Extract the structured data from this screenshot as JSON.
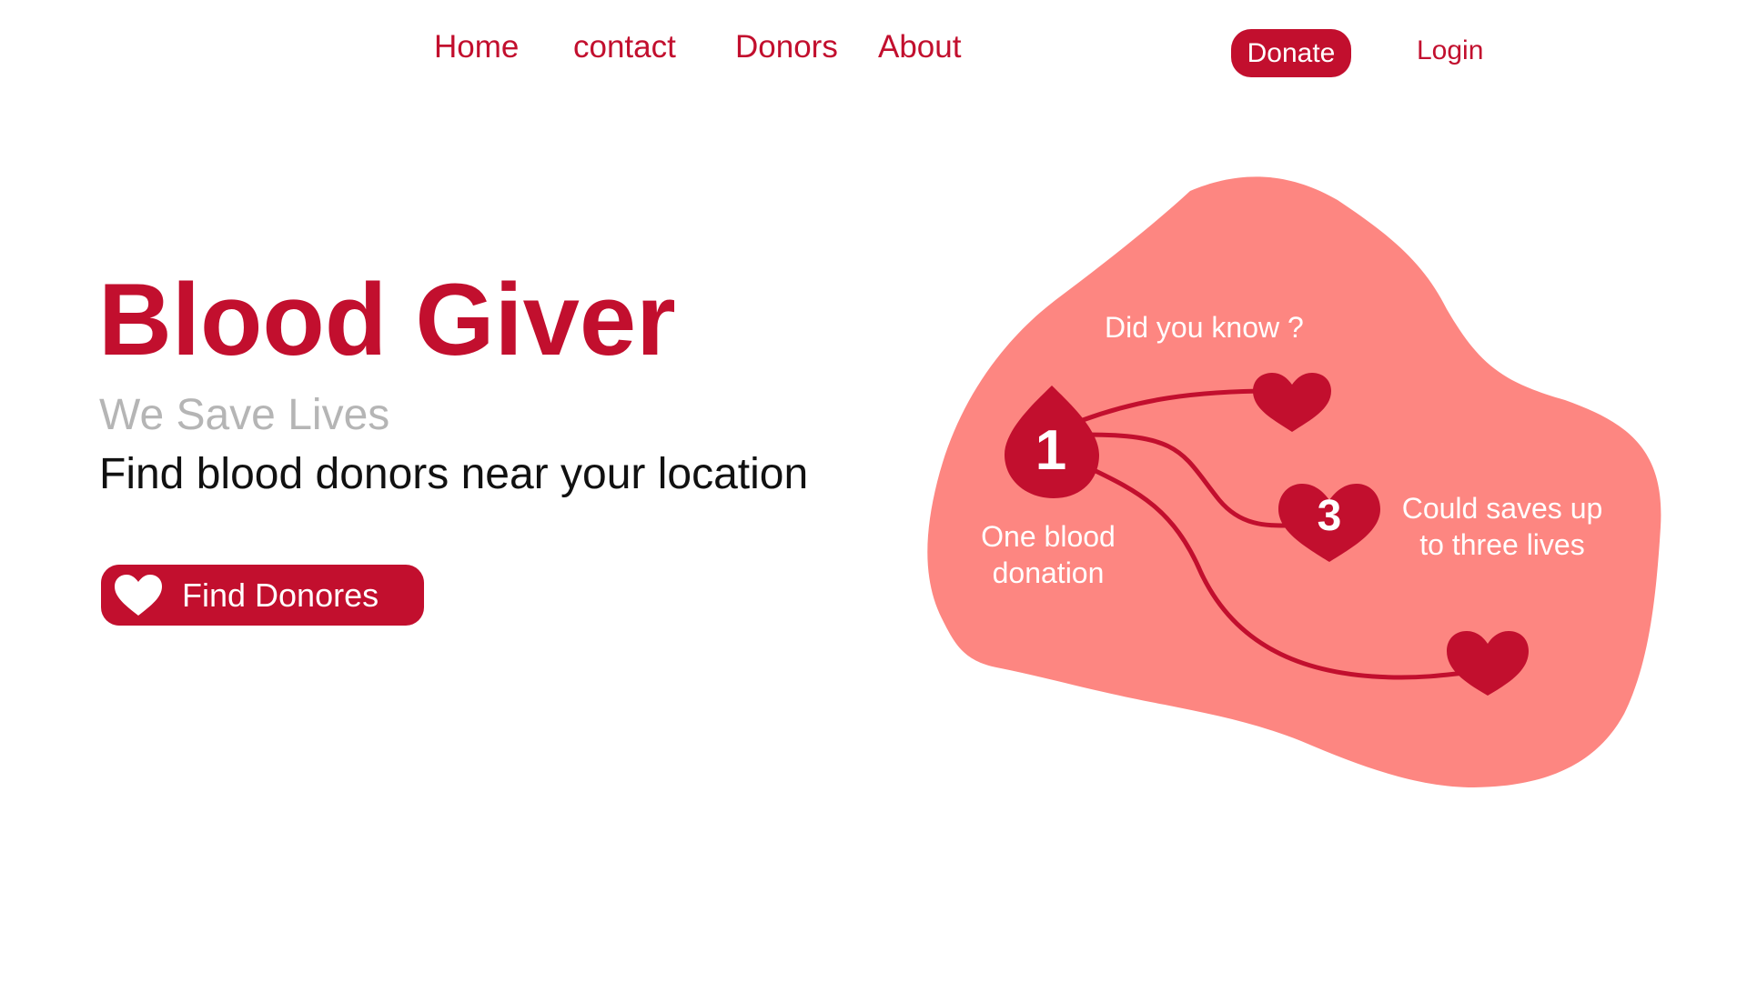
{
  "nav": {
    "home": "Home",
    "contact": "contact",
    "donors": "Donors",
    "about": "About",
    "donate": "Donate",
    "login": "Login"
  },
  "hero": {
    "title": "Blood Giver",
    "tagline": "We Save Lives",
    "subtitle": "Find blood donors near your location",
    "cta_label": "Find Donores",
    "cta_icon": "heart-icon"
  },
  "illustration": {
    "heading": "Did you know ?",
    "one_line1": "One blood",
    "one_line2": "donation",
    "drop_number": "1",
    "heart_number": "3",
    "three_line1": "Could saves up",
    "three_line2": "to three lives"
  },
  "colors": {
    "brand_red": "#c20f2e",
    "blob_salmon": "#fd8681",
    "muted_gray": "#b5b5b5",
    "text_dark": "#111111"
  }
}
